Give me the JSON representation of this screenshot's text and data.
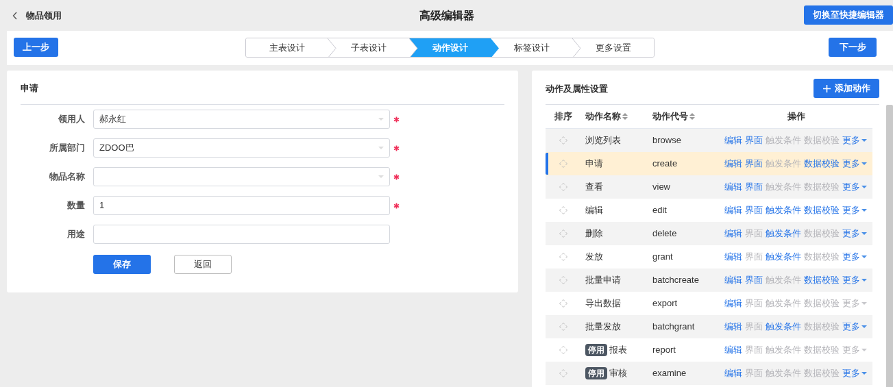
{
  "header": {
    "back_label": "物品领用",
    "title": "高级编辑器",
    "switch_button": "切换至快捷编辑器"
  },
  "steps_bar": {
    "prev_button": "上一步",
    "next_button": "下一步",
    "steps": [
      {
        "label": "主表设计",
        "selected": false
      },
      {
        "label": "子表设计",
        "selected": false
      },
      {
        "label": "动作设计",
        "selected": true
      },
      {
        "label": "标签设计",
        "selected": false
      },
      {
        "label": "更多设置",
        "selected": false
      }
    ]
  },
  "form": {
    "title": "申请",
    "fields": [
      {
        "label": "领用人",
        "kind": "select",
        "value": "郝永红",
        "required": true
      },
      {
        "label": "所属部门",
        "kind": "select",
        "value": "ZDOO巴",
        "required": true
      },
      {
        "label": "物品名称",
        "kind": "select",
        "required": true
      },
      {
        "label": "数量",
        "kind": "text",
        "value": "1",
        "required": true
      },
      {
        "label": "用途",
        "kind": "text",
        "required": false
      }
    ],
    "save_button": "保存",
    "back_button": "返回"
  },
  "actions_panel": {
    "title": "动作及属性设置",
    "add_button": "添加动作",
    "columns": [
      {
        "label": "排序",
        "sortable": false
      },
      {
        "label": "动作名称",
        "sortable": true
      },
      {
        "label": "动作代号",
        "sortable": true
      },
      {
        "label": "操作",
        "sortable": false
      }
    ],
    "rows": [
      {
        "name": "浏览列表",
        "code": "browse",
        "selected": false,
        "ops": [
          {
            "label": "编辑",
            "enabled": true
          },
          {
            "label": "界面",
            "enabled": true
          },
          {
            "label": "触发条件",
            "enabled": false
          },
          {
            "label": "数据校验",
            "enabled": false
          },
          {
            "label": "更多",
            "enabled": true
          }
        ]
      },
      {
        "name": "申请",
        "code": "create",
        "selected": true,
        "ops": [
          {
            "label": "编辑",
            "enabled": true
          },
          {
            "label": "界面",
            "enabled": true
          },
          {
            "label": "触发条件",
            "enabled": false
          },
          {
            "label": "数据校验",
            "enabled": true
          },
          {
            "label": "更多",
            "enabled": true
          }
        ]
      },
      {
        "name": "查看",
        "code": "view",
        "selected": false,
        "ops": [
          {
            "label": "编辑",
            "enabled": true
          },
          {
            "label": "界面",
            "enabled": true
          },
          {
            "label": "触发条件",
            "enabled": false
          },
          {
            "label": "数据校验",
            "enabled": false
          },
          {
            "label": "更多",
            "enabled": true
          }
        ]
      },
      {
        "name": "编辑",
        "code": "edit",
        "selected": false,
        "ops": [
          {
            "label": "编辑",
            "enabled": true
          },
          {
            "label": "界面",
            "enabled": true
          },
          {
            "label": "触发条件",
            "enabled": true
          },
          {
            "label": "数据校验",
            "enabled": true
          },
          {
            "label": "更多",
            "enabled": true
          }
        ]
      },
      {
        "name": "删除",
        "code": "delete",
        "selected": false,
        "ops": [
          {
            "label": "编辑",
            "enabled": true
          },
          {
            "label": "界面",
            "enabled": false
          },
          {
            "label": "触发条件",
            "enabled": true
          },
          {
            "label": "数据校验",
            "enabled": false
          },
          {
            "label": "更多",
            "enabled": true
          }
        ]
      },
      {
        "name": "发放",
        "code": "grant",
        "selected": false,
        "ops": [
          {
            "label": "编辑",
            "enabled": true
          },
          {
            "label": "界面",
            "enabled": false
          },
          {
            "label": "触发条件",
            "enabled": true
          },
          {
            "label": "数据校验",
            "enabled": false
          },
          {
            "label": "更多",
            "enabled": true
          }
        ]
      },
      {
        "name": "批量申请",
        "code": "batchcreate",
        "selected": false,
        "ops": [
          {
            "label": "编辑",
            "enabled": true
          },
          {
            "label": "界面",
            "enabled": true
          },
          {
            "label": "触发条件",
            "enabled": false
          },
          {
            "label": "数据校验",
            "enabled": true
          },
          {
            "label": "更多",
            "enabled": true
          }
        ]
      },
      {
        "name": "导出数据",
        "code": "export",
        "selected": false,
        "ops": [
          {
            "label": "编辑",
            "enabled": true
          },
          {
            "label": "界面",
            "enabled": false
          },
          {
            "label": "触发条件",
            "enabled": false
          },
          {
            "label": "数据校验",
            "enabled": false
          },
          {
            "label": "更多",
            "enabled": false
          }
        ]
      },
      {
        "name": "批量发放",
        "code": "batchgrant",
        "selected": false,
        "ops": [
          {
            "label": "编辑",
            "enabled": true
          },
          {
            "label": "界面",
            "enabled": false
          },
          {
            "label": "触发条件",
            "enabled": true
          },
          {
            "label": "数据校验",
            "enabled": false
          },
          {
            "label": "更多",
            "enabled": true
          }
        ]
      },
      {
        "badge": "停用",
        "name": "报表",
        "code": "report",
        "selected": false,
        "ops": [
          {
            "label": "编辑",
            "enabled": true
          },
          {
            "label": "界面",
            "enabled": false
          },
          {
            "label": "触发条件",
            "enabled": false
          },
          {
            "label": "数据校验",
            "enabled": false
          },
          {
            "label": "更多",
            "enabled": false
          }
        ]
      },
      {
        "badge": "停用",
        "name": "审核",
        "code": "examine",
        "selected": false,
        "ops": [
          {
            "label": "编辑",
            "enabled": true
          },
          {
            "label": "界面",
            "enabled": false
          },
          {
            "label": "触发条件",
            "enabled": false
          },
          {
            "label": "数据校验",
            "enabled": false
          },
          {
            "label": "更多",
            "enabled": true
          }
        ]
      }
    ]
  }
}
